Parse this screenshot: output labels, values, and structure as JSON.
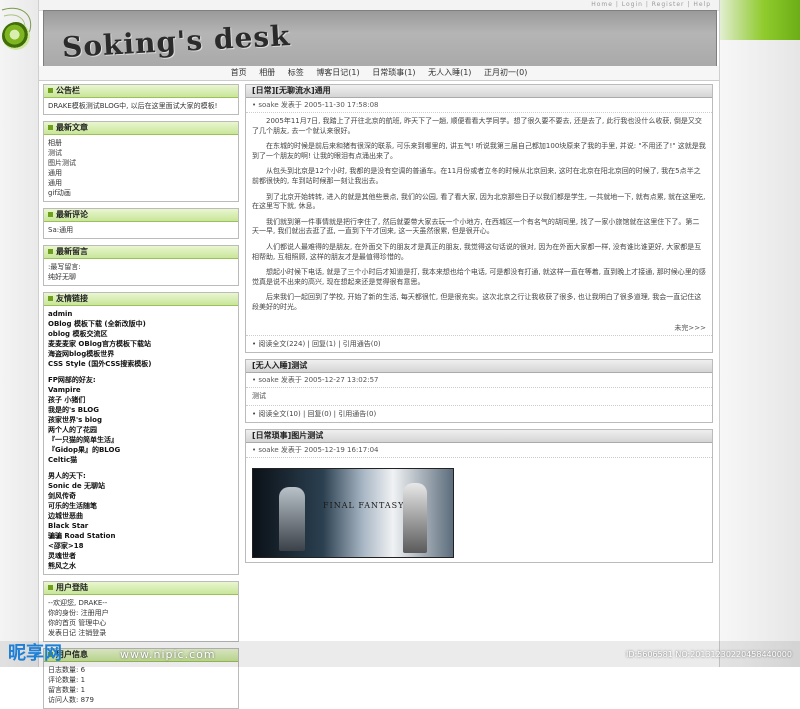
{
  "top_links": "Home | Login | Register | Help",
  "header": {
    "logo": "Soking's desk"
  },
  "nav": [
    "首页",
    "相册",
    "标签",
    "博客日记(1)",
    "日常琐事(1)",
    "无人入睡(1)",
    "正月初一(0)"
  ],
  "sidebar": {
    "announce": {
      "title": "公告栏",
      "text": "DRAKE模板测试BLOG中, 以后在这里面试大家的模板!"
    },
    "categories": {
      "title": "最新文章",
      "items": [
        "相册",
        "测试",
        "图片测试",
        "通用",
        "通用",
        "gif动画"
      ]
    },
    "comments": {
      "title": "最新评论",
      "items": [
        "Sa:通用"
      ]
    },
    "messages": {
      "title": "最新留言",
      "items": [
        ":最写留言:",
        "纯好无聊"
      ]
    },
    "links": {
      "title": "友情链接",
      "group1": [
        "admin",
        "OBlog 模板下载 (全新改版中)",
        "oblog 模板交流区",
        "麦麦麦家 OBlog官方模板下载站",
        "海盗网blog模板世界",
        "CSS Style (国外CSS搜索模板)"
      ],
      "group2": [
        "FP网部的好友:",
        "Vampire",
        "孩子 小猪们",
        "我是的's BLOG",
        "孩家世界's blog",
        "两个人的了花园",
        "『一只猫的简单生活』",
        "『Gidop果』的BLOG",
        "Celtic猫"
      ],
      "group3": [
        "男人的天下:",
        "Sonic de 无聊站",
        "剑风传奇",
        "可乐的生活随笔",
        "边城世恶曲",
        "Black Star",
        "骗骗 Road Station",
        "<邵家>18",
        "灵魂世者",
        "熊风之水"
      ]
    },
    "user": {
      "title": "用户登陆",
      "items": [
        "--欢迎您, DRAKE--",
        "你的身份: 注册用户",
        "你的首页  管理中心",
        "发表日记  注销登录"
      ]
    },
    "stats": {
      "title": "用户信息",
      "items": [
        "日志数量: 6",
        "评论数量: 1",
        "留言数量: 1",
        "访问人数: 879"
      ]
    }
  },
  "posts": [
    {
      "title": "[日常][无聊流水]通用",
      "meta": "• soake 发表于 2005-11-30 17:58:08",
      "paras": [
        "2005年11月7日, 我踏上了开往北京的航班, 昨天下了一趟, 顺便看看大学同学。想了很久要不要去, 还是去了, 此行我也没什么收获, 倒是又交了几个朋友, 去一个就认来很好。",
        "在东城的时候是前后来和猪有很深的联系, 可乐来到哪里的, 讲五气! 听说我第三届自己都加100块原来了我的手里, 并说: \"不用还了!\" 这就是我到了一个朋友的啊! 让我的眼泪有点涌出来了。",
        "从包头到北京是12个小时, 我都的是没有空调的普通车。在11月份或者立冬的时候从北京回来, 这时在北京在阳北京回的时候了, 我在5点半之前都很快的, 车到站时候那一刻让我出去。",
        "到了北京开始转转, 进入的就是其他些景点, 我们的公园, 看了看大家, 因为北京那些日子以我们都是学生, 一共就地一下, 就有点累, 就在这里吃, 在这里写下就, 休息。",
        "我们就到第一件事情就是把行李住了, 然后就要带大家去玩一个小地方, 在西城区一个有名气的胡同里, 找了一家小旅馆就在这里住下了。第二天一早, 我们就出去逛了逛, 一直到下午才回来, 这一天虽然很累, 但是很开心。",
        "人们都说人最难得的是朋友, 在外面交下的朋友才是真正的朋友, 我觉得这句话说的很对, 因为在外面大家都一样, 没有谁比谁更好, 大家都是互相帮助, 互相照顾, 这样的朋友才是最值得珍惜的。",
        "想起小时候下电话, 就是了三个小时后才知道是打, 我本来想也给个电话, 可是都没有打通, 就这样一直在等着, 直到晚上才接通, 那时候心里的感觉真是说不出来的高兴, 现在想起来还是觉得很有意思。",
        "后来我们一起回到了学校, 开始了新的生活, 每天都很忙, 但是很充实。这次北京之行让我收获了很多, 也让我明白了很多道理, 我会一直记住这段美好的时光。"
      ],
      "more": "未完>>>",
      "foot": "• 阅读全文(224) | 回复(1) | 引用通告(0)"
    },
    {
      "title": "[无人入睡]测试",
      "meta": "• soake 发表于 2005-12-27 13:02:57",
      "body": "测试",
      "foot": "• 阅读全文(10) | 回复(0) | 引用通告(0)"
    },
    {
      "title": "[日常琐事]图片测试",
      "meta": "• soake 发表于 2005-12-19 16:17:04",
      "image_title": "FINAL FANTASY VII"
    }
  ],
  "watermark": {
    "logo": "昵享网",
    "url": "www.nipic.com",
    "id": "ID:5606581 NO:20131230220458440000"
  }
}
